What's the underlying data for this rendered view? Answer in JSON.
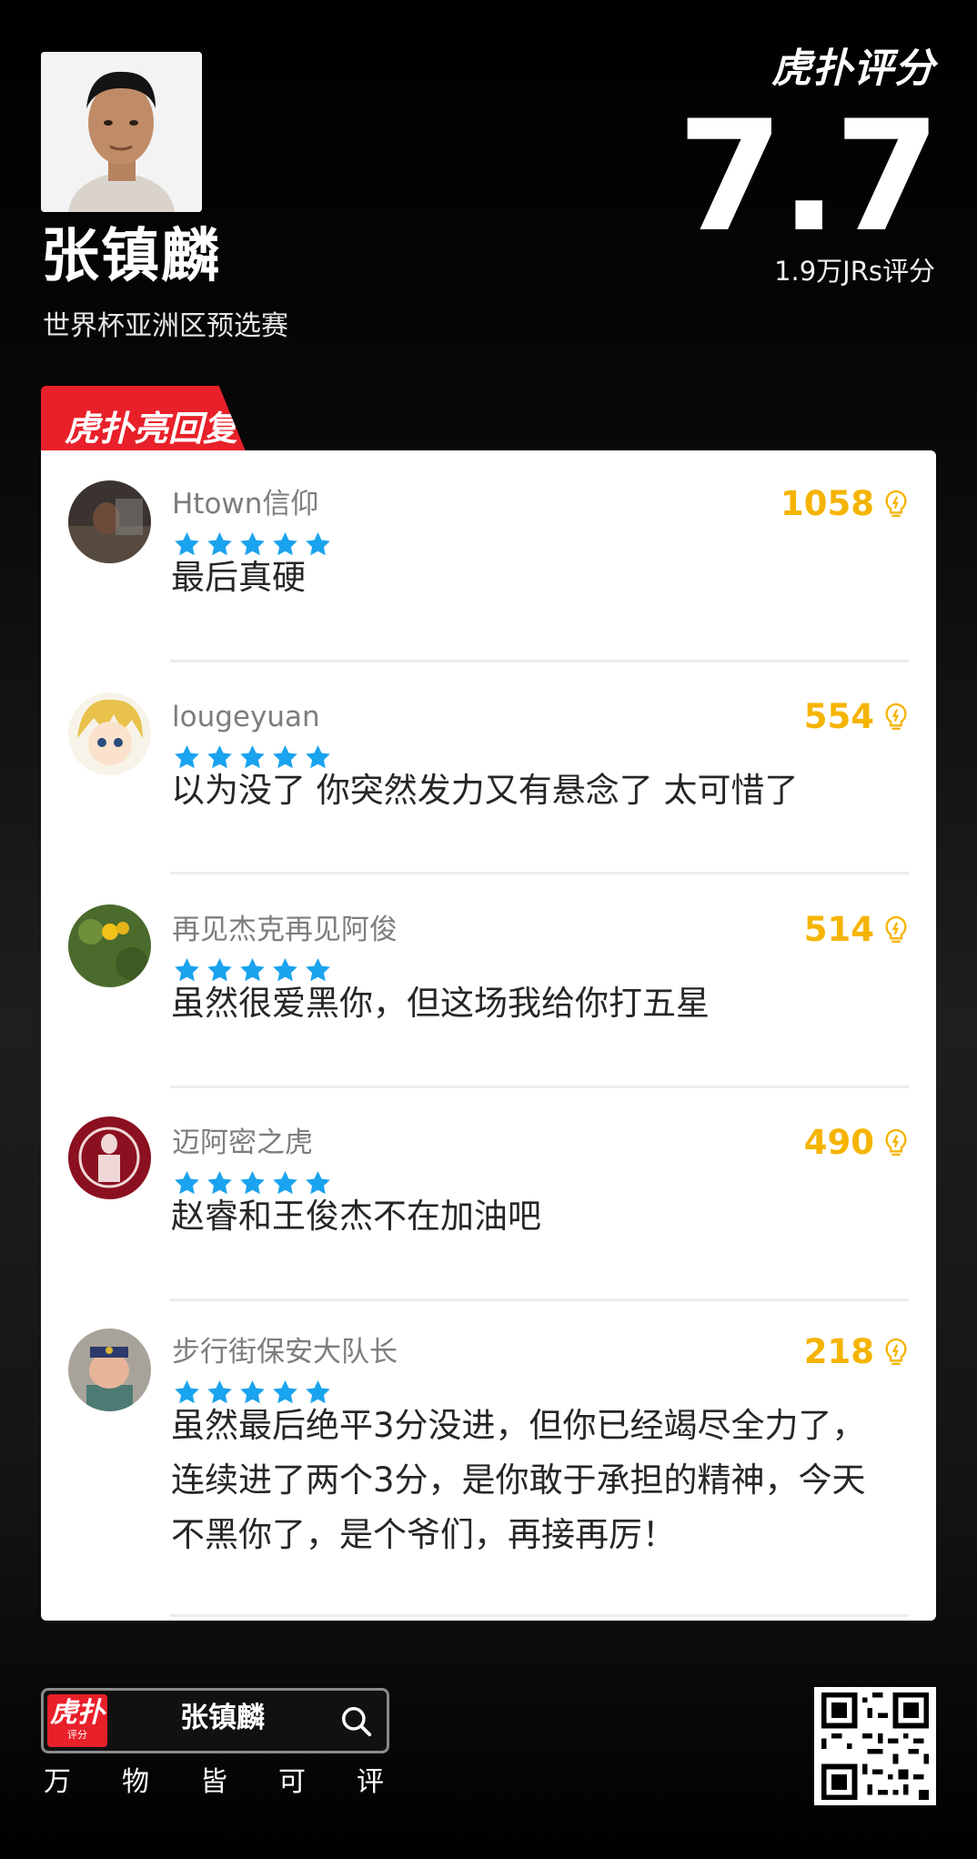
{
  "header": {
    "player_name": "张镇麟",
    "event": "世界杯亚洲区预选赛",
    "brand_logo": "虎扑评分",
    "score": "7.7",
    "rating_count": "1.9万JRs评分"
  },
  "section_tab": {
    "label": "虎扑亮回复"
  },
  "comments": [
    {
      "username": "Htown信仰",
      "rating_stars": 5,
      "likes": "1058",
      "text": "最后真硬"
    },
    {
      "username": "lougeyuan",
      "rating_stars": 5,
      "likes": "554",
      "text": "以为没了 你突然发力又有悬念了 太可惜了"
    },
    {
      "username": "再见杰克再见阿俊",
      "rating_stars": 5,
      "likes": "514",
      "text": "虽然很爱黑你，但这场我给你打五星"
    },
    {
      "username": "迈阿密之虎",
      "rating_stars": 5,
      "likes": "490",
      "text": "赵睿和王俊杰不在加油吧"
    },
    {
      "username": "步行街保安大队长",
      "rating_stars": 5,
      "likes": "218",
      "text_lines": [
        "虽然最后绝平3分没进，但你已经竭尽全力了，",
        "连续进了两个3分，是你敢于承担的精神，今天",
        "不黑你了，是个爷们，再接再厉！"
      ]
    }
  ],
  "footer": {
    "logo_main": "虎扑",
    "logo_sub": "评分",
    "search_text": "张镇麟",
    "slogan": [
      "万",
      "物",
      "皆",
      "可",
      "评"
    ]
  },
  "colors": {
    "accent_red": "#e8202a",
    "star_blue": "#1aa3ee",
    "like_gold": "#f5b400"
  },
  "icons": {
    "star": "star-icon",
    "like": "lightbulb-icon",
    "search": "search-icon",
    "qr": "qr-code-icon"
  }
}
